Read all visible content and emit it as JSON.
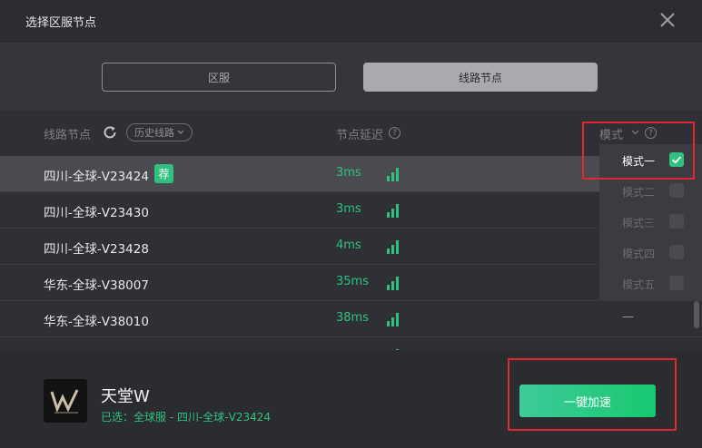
{
  "window": {
    "title": "选择区服节点"
  },
  "tabs": {
    "region_label": "区服",
    "node_label": "线路节点"
  },
  "header": {
    "node_col": "线路节点",
    "history_pill": "历史线路",
    "latency_col": "节点延迟",
    "mode_col": "模式"
  },
  "rows": [
    {
      "name": "四川-全球-V23424",
      "badge": "荐",
      "latency": "3ms",
      "mode": ""
    },
    {
      "name": "四川-全球-V23430",
      "badge": "",
      "latency": "3ms",
      "mode": ""
    },
    {
      "name": "四川-全球-V23428",
      "badge": "",
      "latency": "4ms",
      "mode": ""
    },
    {
      "name": "华东-全球-V38007",
      "badge": "",
      "latency": "35ms",
      "mode": ""
    },
    {
      "name": "华东-全球-V38010",
      "badge": "",
      "latency": "38ms",
      "mode": "—"
    }
  ],
  "mode_menu": {
    "items": [
      {
        "label": "模式一",
        "checked": true
      },
      {
        "label": "模式二",
        "checked": false
      },
      {
        "label": "模式三",
        "checked": false
      },
      {
        "label": "模式四",
        "checked": false
      },
      {
        "label": "模式五",
        "checked": false
      }
    ]
  },
  "footer": {
    "game_name": "天堂W",
    "selection": "已选：全球服 - 四川-全球-V23424",
    "accelerate_label": "一键加速"
  },
  "colors": {
    "accent_green": "#2ec17f",
    "highlight_red": "#e0282e",
    "background": "#2c2d31"
  }
}
